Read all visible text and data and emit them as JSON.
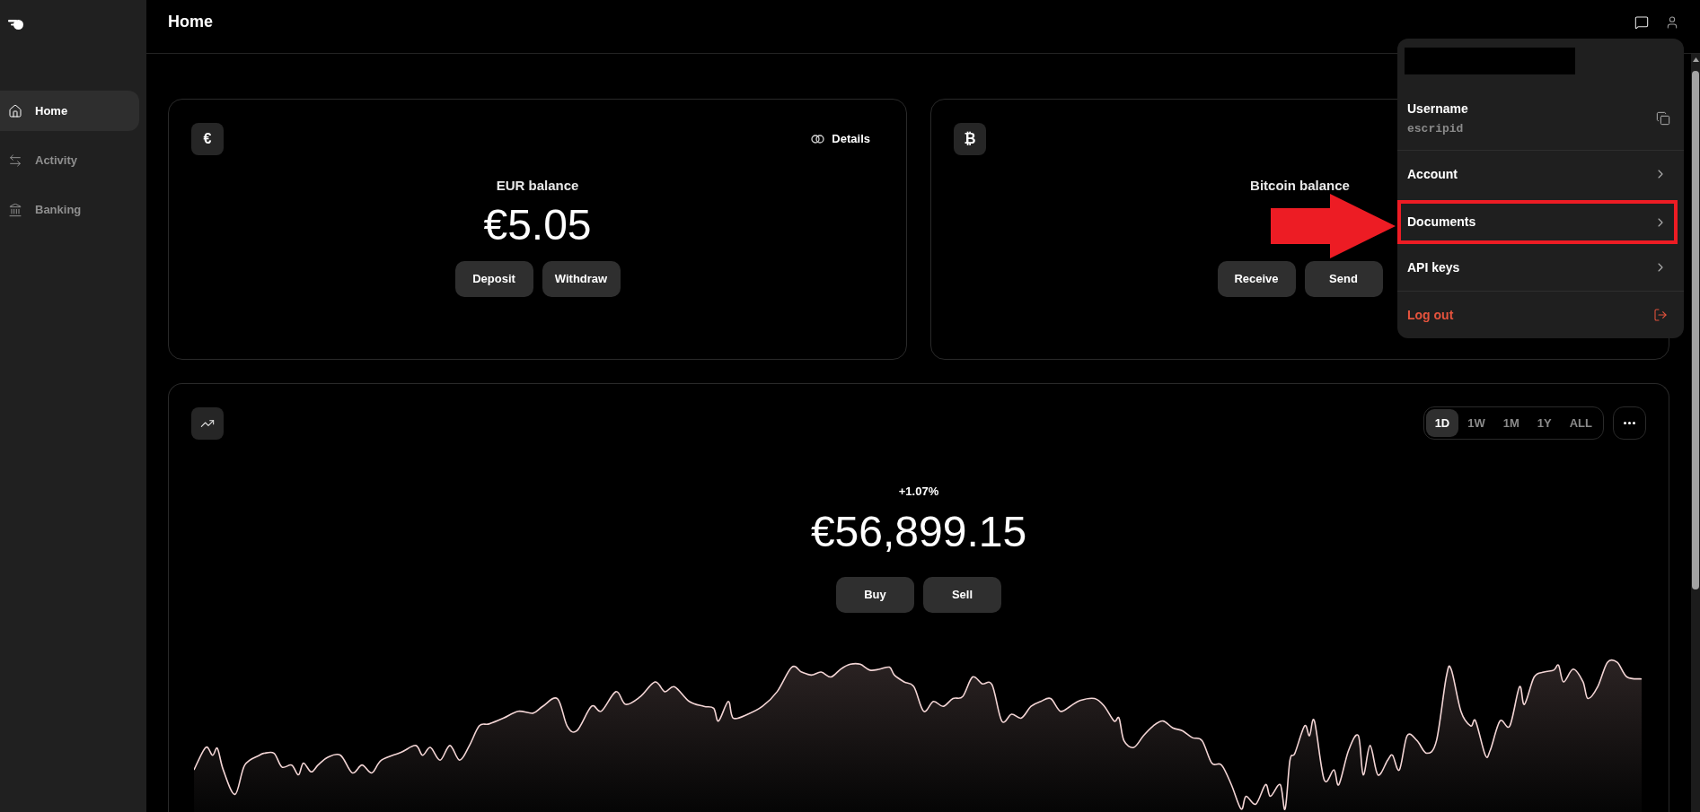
{
  "sidebar": {
    "items": [
      {
        "label": "Home",
        "selected": true
      },
      {
        "label": "Activity",
        "selected": false
      },
      {
        "label": "Banking",
        "selected": false
      }
    ]
  },
  "header": {
    "title": "Home"
  },
  "balances": [
    {
      "symbol": "€",
      "title": "EUR balance",
      "amount": "€5.05",
      "details": "Details",
      "actions": [
        "Deposit",
        "Withdraw"
      ]
    },
    {
      "symbol": "₿",
      "title": "Bitcoin balance",
      "actions": [
        "Receive",
        "Send"
      ]
    }
  ],
  "price_card": {
    "ranges": [
      {
        "label": "1D",
        "selected": true
      },
      {
        "label": "1W",
        "selected": false
      },
      {
        "label": "1M",
        "selected": false
      },
      {
        "label": "1Y",
        "selected": false
      },
      {
        "label": "ALL",
        "selected": false
      }
    ],
    "change": "+1.07%",
    "price": "€56,899.15",
    "actions": [
      "Buy",
      "Sell"
    ]
  },
  "account_menu": {
    "username_label": "Username",
    "username": "escripid",
    "items": [
      {
        "kind": "link",
        "label": "Account",
        "highlighted": false
      },
      {
        "kind": "link",
        "label": "Documents",
        "highlighted": true
      },
      {
        "kind": "link",
        "label": "API keys",
        "highlighted": false
      },
      {
        "kind": "logout",
        "label": "Log out",
        "highlighted": false
      }
    ]
  }
}
